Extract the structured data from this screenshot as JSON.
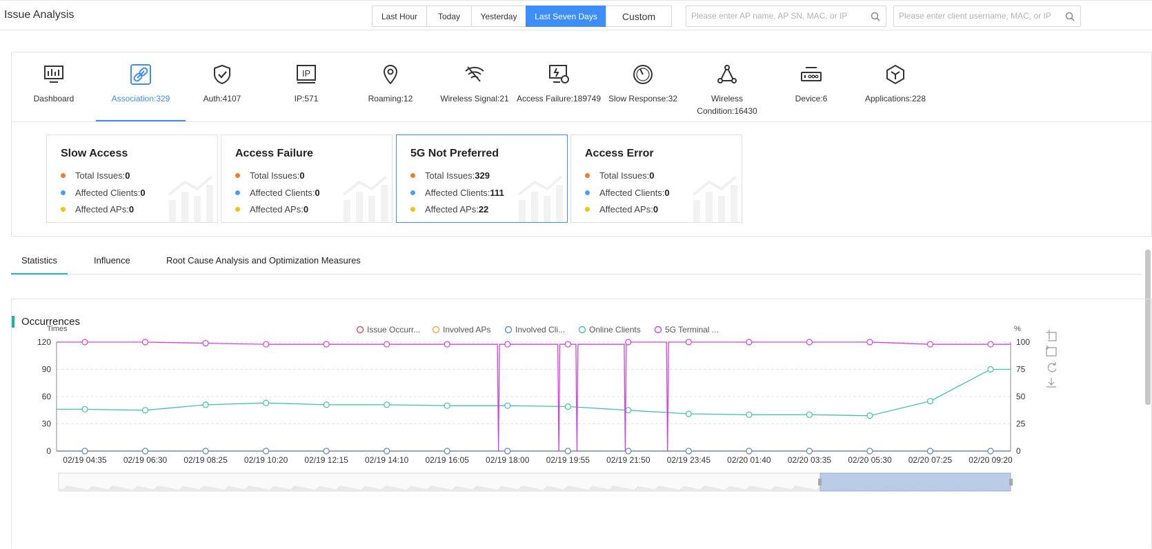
{
  "header": {
    "title": "Issue Analysis",
    "time_ranges": [
      "Last Hour",
      "Today",
      "Yesterday",
      "Last Seven Days",
      "Custom"
    ],
    "active_range": "Last Seven Days",
    "ap_search_placeholder": "Please enter AP name, AP SN, MAC, or IP",
    "client_search_placeholder": "Please enter client username, MAC, or IP"
  },
  "categories": [
    {
      "label": "Dashboard",
      "icon": "monitor-chart-icon"
    },
    {
      "label": "Association:329",
      "icon": "link-icon",
      "active": true
    },
    {
      "label": "Auth:4107",
      "icon": "shield-check-icon"
    },
    {
      "label": "IP:571",
      "icon": "ip-icon"
    },
    {
      "label": "Roaming:12",
      "icon": "location-pin-icon"
    },
    {
      "label": "Wireless Signal:21",
      "icon": "wifi-off-icon"
    },
    {
      "label": "Access Failure:189749",
      "icon": "screen-alert-icon"
    },
    {
      "label": "Slow Response:32",
      "icon": "gauge-icon"
    },
    {
      "label": "Wireless Condition:16430",
      "icon": "network-triangle-icon"
    },
    {
      "label": "Device:6",
      "icon": "router-icon"
    },
    {
      "label": "Applications:228",
      "icon": "cube-icon"
    }
  ],
  "cards": [
    {
      "title": "Slow Access",
      "total": "0",
      "clients": "0",
      "aps": "0",
      "selected": false
    },
    {
      "title": "Access Failure",
      "total": "0",
      "clients": "0",
      "aps": "0",
      "selected": false
    },
    {
      "title": "5G Not Preferred",
      "total": "329",
      "clients": "111",
      "aps": "22",
      "selected": true
    },
    {
      "title": "Access Error",
      "total": "0",
      "clients": "0",
      "aps": "0",
      "selected": false
    }
  ],
  "card_labels": {
    "total": "Total Issues:",
    "clients": "Affected Clients:",
    "aps": "Affected APs:"
  },
  "card_colors": {
    "total": "#f07c2a",
    "clients": "#4d9df5",
    "aps": "#f5c211"
  },
  "tabs": [
    {
      "label": "Statistics",
      "active": true
    },
    {
      "label": "Influence",
      "active": false
    },
    {
      "label": "Root Cause Analysis and Optimization Measures",
      "active": false
    }
  ],
  "chart_panel": {
    "title": "Occurrences"
  },
  "chart_data": {
    "type": "line",
    "title": "",
    "ylabel_left": "Times",
    "ylabel_right": "%",
    "ylim_left": [
      0,
      120
    ],
    "ylim_right": [
      0,
      100
    ],
    "yticks_left": [
      "0",
      "30",
      "60",
      "90",
      "120"
    ],
    "yticks_right": [
      "0",
      "25",
      "50",
      "75",
      "100"
    ],
    "xticks": [
      "02/19 04:35",
      "02/19 06:30",
      "02/19 08:25",
      "02/19 10:20",
      "02/19 12:15",
      "02/19 14:10",
      "02/19 16:05",
      "02/19 18:00",
      "02/19 19:55",
      "02/19 21:50",
      "02/19 23:45",
      "02/20 01:40",
      "02/20 03:35",
      "02/20 05:30",
      "02/20 07:25",
      "02/20 09:20"
    ],
    "legend_position": "top-center",
    "grid": true,
    "series": [
      {
        "name": "Issue Occurr...",
        "color": "#f0485f",
        "axis": "left",
        "values": [
          0,
          0,
          0,
          0,
          0,
          0,
          0,
          0,
          0,
          0,
          0,
          0,
          0,
          0,
          0,
          0
        ]
      },
      {
        "name": "Involved APs",
        "color": "#f5a742",
        "axis": "left",
        "values": [
          0,
          0,
          0,
          0,
          0,
          0,
          0,
          0,
          0,
          0,
          0,
          0,
          0,
          0,
          0,
          0
        ]
      },
      {
        "name": "Involved Cli...",
        "color": "#5b8fd6",
        "axis": "left",
        "values": [
          0,
          0,
          0,
          0,
          0,
          0,
          0,
          0,
          0,
          0,
          0,
          0,
          0,
          0,
          0,
          0
        ]
      },
      {
        "name": "Online Clients",
        "color": "#3ec6a5",
        "axis": "left",
        "values": [
          46,
          45,
          51,
          53,
          51,
          51,
          50,
          50,
          49,
          45,
          41,
          40,
          40,
          39,
          55,
          90
        ]
      },
      {
        "name": "5G Terminal ...",
        "color": "#d63ee8",
        "axis": "right",
        "values": [
          100,
          100,
          99,
          98,
          98,
          98,
          98,
          98,
          98,
          100,
          100,
          100,
          100,
          100,
          98,
          98
        ]
      }
    ],
    "dips_5g": [
      {
        "x": 6.85,
        "value": 0
      },
      {
        "x": 7.85,
        "value": 0
      },
      {
        "x": 8.15,
        "value": 0
      },
      {
        "x": 8.95,
        "value": 0
      },
      {
        "x": 9.65,
        "value": 0
      }
    ],
    "zoom_window": [
      0.8,
      1.0
    ]
  }
}
